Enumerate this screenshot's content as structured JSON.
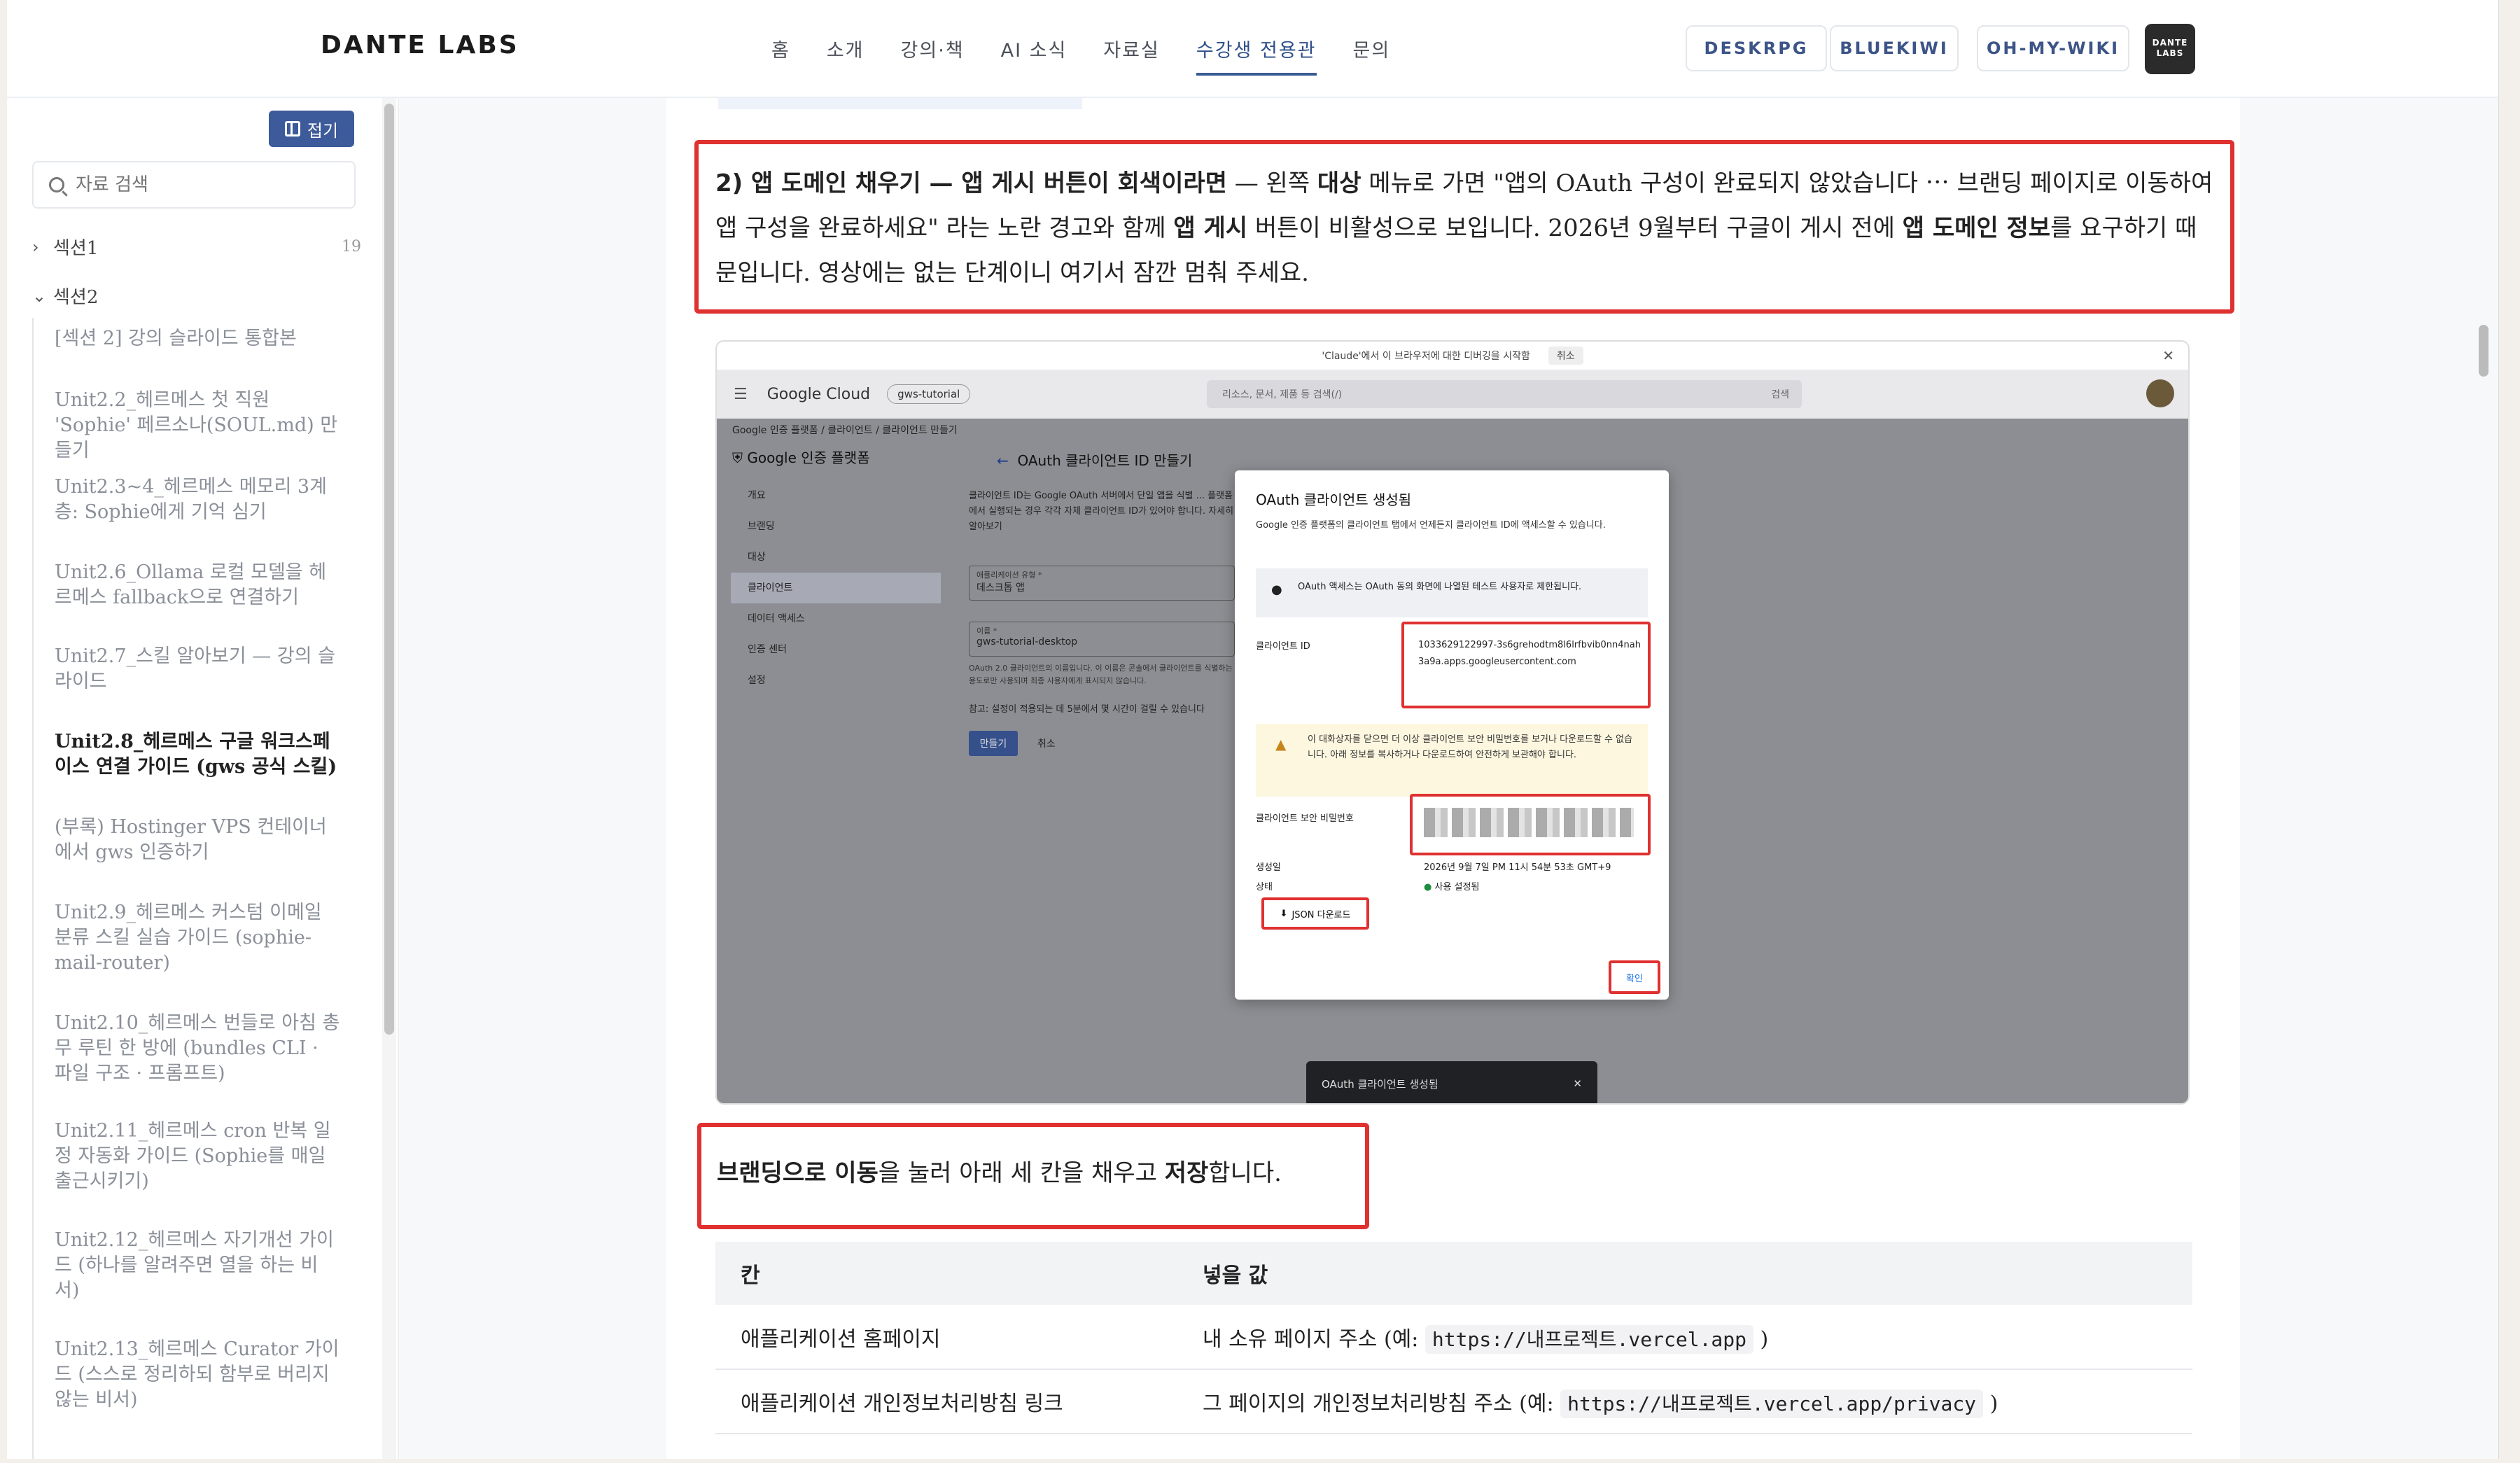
{
  "header": {
    "logo": "DANTE LABS",
    "nav": [
      "홈",
      "소개",
      "강의·책",
      "AI 소식",
      "자료실",
      "수강생 전용관",
      "문의"
    ],
    "active_nav": "수강생 전용관",
    "pills": [
      "DESKRPG",
      "BLUEKIWI",
      "OH-MY-WIKI"
    ],
    "brand_badge": [
      "DANTE",
      "LABS"
    ]
  },
  "sidebar": {
    "collapse_label": "접기",
    "search_placeholder": "자료 검색",
    "sections": [
      {
        "label": "섹션1",
        "count": "19",
        "expanded": false
      },
      {
        "label": "섹션2",
        "count": "",
        "expanded": true
      }
    ],
    "items": [
      "[섹션 2] 강의 슬라이드 통합본",
      "Unit2.2_헤르메스 첫 직원 'Sophie' 페르소나(SOUL.md) 만들기",
      "Unit2.3~4_헤르메스 메모리 3계층: Sophie에게 기억 심기",
      "Unit2.6_Ollama 로컬 모델을 헤르메스 fallback으로 연결하기",
      "Unit2.7_스킬 알아보기 — 강의 슬라이드",
      "Unit2.8_헤르메스 구글 워크스페이스 연결 가이드 (gws 공식 스킬)",
      "(부록) Hostinger VPS 컨테이너에서 gws 인증하기",
      "Unit2.9_헤르메스 커스텀 이메일 분류 스킬 실습 가이드 (sophie-mail-router)",
      "Unit2.10_헤르메스 번들로 아침 총무 루틴 한 방에 (bundles CLI · 파일 구조 · 프롬프트)",
      "Unit2.11_헤르메스 cron 반복 일정 자동화 가이드 (Sophie를 매일 출근시키기)",
      "Unit2.12_헤르메스 자기개선 가이드 (하나를 알려주면 열을 하는 비서)",
      "Unit2.13_헤르메스 Curator 가이드 (스스로 정리하되 함부로 버리지 않는 비서)"
    ],
    "active_index": 5
  },
  "content": {
    "step2": {
      "lead": "2) 앱 도메인 채우기 — 앱 게시 버튼이 회색이라면",
      "t1": " — 왼쪽 ",
      "b1": "대상",
      "t2": " 메뉴로 가면 \"앱의 OAuth 구성이 완료되지 않았습니다 ⋯ 브랜딩 페이지로 이동하여 앱 구성을 완료하세요\" 라는 노란 경고와 함께 ",
      "b2": "앱 게시",
      "t3": " 버튼이 비활성으로 보입니다. 2026년 9월부터 구글이 게시 전에 ",
      "b3": "앱 도메인 정보",
      "t4": "를 요구하기 때문입니다. 영상에는 없는 단계이니 여기서 잠깐 멈춰 주세요."
    },
    "screenshot": {
      "topbar_text": "'Claude'에서 이 브라우저에 대한 디버깅을 시작함",
      "topbar_cancel": "취소",
      "gc_logo": "Google Cloud",
      "project": "gws-tutorial",
      "search_placeholder": "리소스, 문서, 제품 등 검색(/)",
      "search_btn": "검색",
      "breadcrumb": "Google 인증 플랫폼  /  클라이언트  /  클라이언트 만들기",
      "platform_title": "Google 인증 플랫폼",
      "page_title": "OAuth 클라이언트 ID 만들기",
      "left_menu": [
        "개요",
        "브랜딩",
        "대상",
        "클라이언트",
        "데이터 액세스",
        "인증 센터",
        "설정"
      ],
      "left_active": "클라이언트",
      "form_desc": "클라이언트 ID는 Google OAuth 서버에서 단일 앱을 식별 ... 플랫폼에서 실행되는 경우 각각 자체 클라이언트 ID가 있어야 합니다. 자세히 알아보기",
      "app_type_label": "애플리케이션 유형 *",
      "app_type_value": "데스크톱 앱",
      "name_label": "이름 *",
      "name_value": "gws-tutorial-desktop",
      "name_help": "OAuth 2.0 클라이언트의 이름입니다. 이 이름은 콘솔에서 클라이언트를 식별하는 용도로만 사용되며 최종 사용자에게 표시되지 않습니다.",
      "note": "참고: 설정이 적용되는 데 5분에서 몇 시간이 걸릴 수 있습니다",
      "create_btn": "만들기",
      "cancel_btn": "취소",
      "modal": {
        "title": "OAuth 클라이언트 생성됨",
        "desc": "Google 인증 플랫폼의 클라이언트 탭에서 언제든지 클라이언트 ID에 액세스할 수 있습니다.",
        "info": "OAuth 액세스는 OAuth 동의 화면에 나열된 테스트 사용자로 제한됩니다.",
        "client_id_label": "클라이언트 ID",
        "client_id": "1033629122997-3s6grehodtm8l6lrfbvib0nn4nah3a9a.apps.googleusercontent.com",
        "warning": "이 대화상자를 닫으면 더 이상 클라이언트 보안 비밀번호를 보거나 다운로드할 수 없습니다. 아래 정보를 복사하거나 다운로드하여 안전하게 보관해야 합니다.",
        "secret_label": "클라이언트 보안 비밀번호",
        "created_label": "생성일",
        "created_value": "2026년 9월 7일 PM 11시 54분 53초 GMT+9",
        "status_label": "상태",
        "status_value": "사용 설정됨",
        "json_btn": "JSON 다운로드",
        "ok_btn": "확인"
      },
      "toast": "OAuth 클라이언트 생성됨",
      "toast_close": "✕"
    },
    "branding": {
      "b1": "브랜딩으로 이동",
      "t1": "을 눌러 아래 세 칸을 채우고 ",
      "b2": "저장",
      "t2": "합니다."
    },
    "table": {
      "headers": [
        "칸",
        "넣을 값"
      ],
      "rows": [
        {
          "field": "애플리케이션 홈페이지",
          "prefix": "내 소유 페이지 주소 (예: ",
          "code": "https://내프로젝트.vercel.app",
          "suffix": " )"
        },
        {
          "field": "애플리케이션 개인정보처리방침 링크",
          "prefix": "그 페이지의 개인정보처리방침 주소 (예: ",
          "code": "https://내프로젝트.vercel.app/privacy",
          "suffix": " )"
        }
      ]
    }
  },
  "colors": {
    "accent": "#3d5a9a",
    "highlight": "#e03131",
    "google_blue": "#1a73e8"
  }
}
